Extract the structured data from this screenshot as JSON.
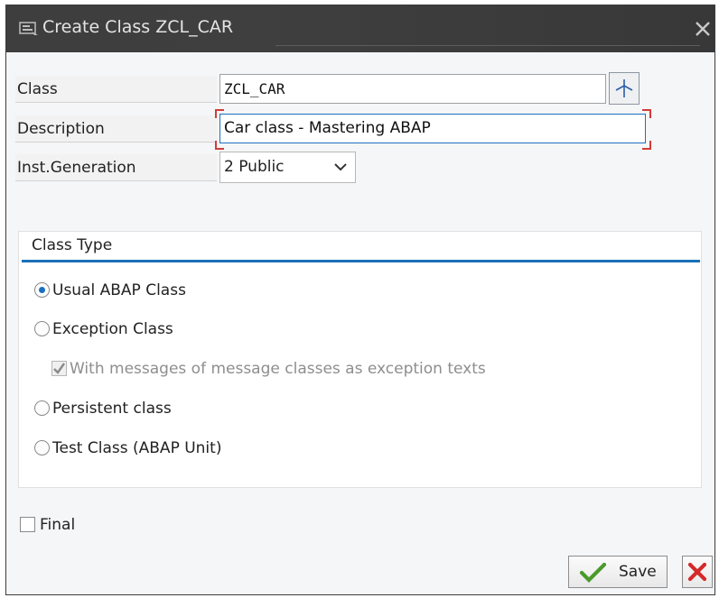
{
  "dialog": {
    "title": "Create Class ZCL_CAR"
  },
  "fields": {
    "class": {
      "label": "Class",
      "value": "ZCL_CAR"
    },
    "description": {
      "label": "Description",
      "value": "Car class - Mastering ABAP"
    },
    "inst_generation": {
      "label": "Inst.Generation",
      "value": "2 Public"
    }
  },
  "class_type": {
    "title": "Class Type",
    "options": [
      {
        "label": "Usual ABAP Class",
        "selected": true
      },
      {
        "label": "Exception Class",
        "selected": false
      },
      {
        "label": "With messages of message classes as exception texts",
        "type": "checkbox",
        "checked": true,
        "enabled": false
      },
      {
        "label": "Persistent class",
        "selected": false
      },
      {
        "label": "Test Class (ABAP Unit)",
        "selected": false
      }
    ]
  },
  "final": {
    "label": "Final",
    "checked": false
  },
  "footer": {
    "save_label": "Save"
  },
  "icons": {
    "title": "dialog-icon",
    "close": "close-icon",
    "search_help": "search-help-icon",
    "save": "checkmark-icon",
    "cancel": "cancel-icon",
    "dropdown": "chevron-down-icon"
  },
  "colors": {
    "titlebar": "#3e3e3e",
    "accent": "#1a70b8",
    "save_check": "#4a9a2c",
    "cancel_x": "#d42a2a"
  }
}
